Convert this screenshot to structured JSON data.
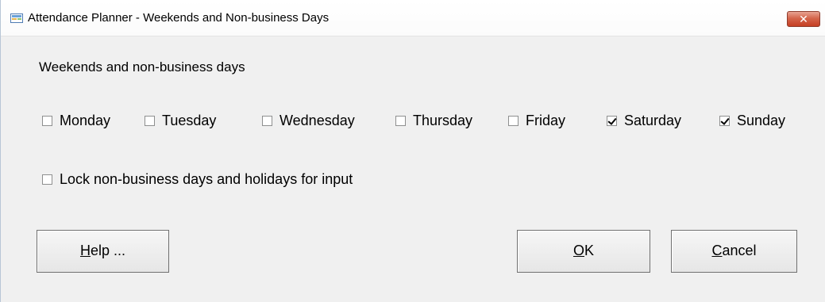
{
  "window": {
    "title": "Attendance Planner - Weekends and Non-business Days",
    "close_label": "✕"
  },
  "heading": "Weekends and non-business days",
  "days": [
    {
      "label": "Monday",
      "checked": false
    },
    {
      "label": "Tuesday",
      "checked": false
    },
    {
      "label": "Wednesday",
      "checked": false
    },
    {
      "label": "Thursday",
      "checked": false
    },
    {
      "label": "Friday",
      "checked": false
    },
    {
      "label": "Saturday",
      "checked": true
    },
    {
      "label": "Sunday",
      "checked": true
    }
  ],
  "lock_option": {
    "label": "Lock non-business days and holidays for input",
    "checked": false
  },
  "buttons": {
    "help": {
      "mnemonic": "H",
      "rest": "elp ..."
    },
    "ok": {
      "mnemonic": "O",
      "rest": "K"
    },
    "cancel": {
      "mnemonic": "C",
      "rest": "ancel"
    }
  },
  "icons": {
    "app": "calendar-app-icon",
    "close": "close-icon"
  }
}
